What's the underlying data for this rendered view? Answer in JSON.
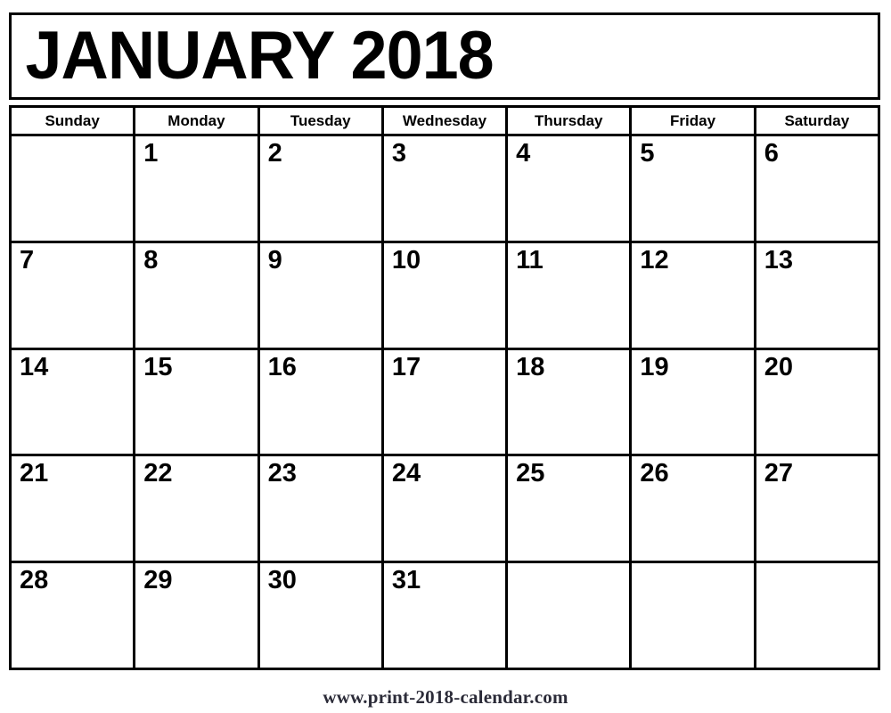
{
  "title": "JANUARY 2018",
  "weekdays": [
    "Sunday",
    "Monday",
    "Tuesday",
    "Wednesday",
    "Thursday",
    "Friday",
    "Saturday"
  ],
  "weeks": [
    [
      "",
      "1",
      "2",
      "3",
      "4",
      "5",
      "6"
    ],
    [
      "7",
      "8",
      "9",
      "10",
      "11",
      "12",
      "13"
    ],
    [
      "14",
      "15",
      "16",
      "17",
      "18",
      "19",
      "20"
    ],
    [
      "21",
      "22",
      "23",
      "24",
      "25",
      "26",
      "27"
    ],
    [
      "28",
      "29",
      "30",
      "31",
      "",
      "",
      ""
    ]
  ],
  "footer": "www.print-2018-calendar.com",
  "colors": {
    "border": "#000000",
    "text": "#000000",
    "background": "#ffffff",
    "footer_text": "#2b2b38"
  }
}
